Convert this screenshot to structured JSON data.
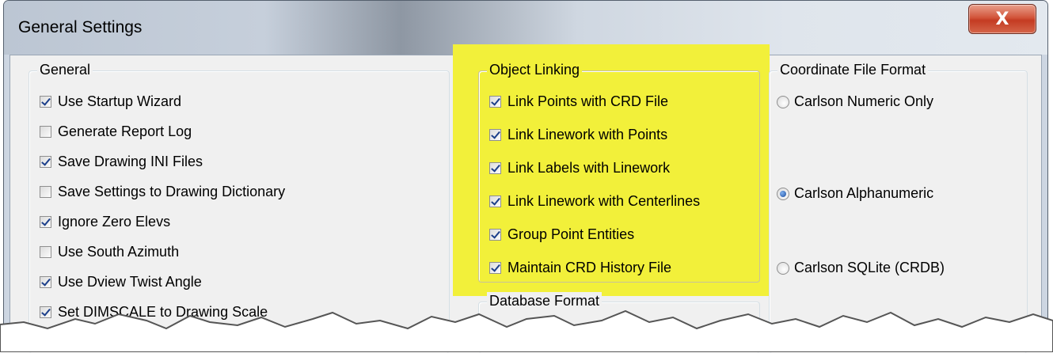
{
  "window": {
    "title": "General Settings",
    "close_icon": "close-icon",
    "close_label": "X"
  },
  "general": {
    "label": "General",
    "items": [
      {
        "label": "Use Startup Wizard",
        "checked": true
      },
      {
        "label": "Generate Report Log",
        "checked": false
      },
      {
        "label": "Save Drawing INI Files",
        "checked": true
      },
      {
        "label": "Save Settings to Drawing Dictionary",
        "checked": false
      },
      {
        "label": "Ignore Zero Elevs",
        "checked": true
      },
      {
        "label": "Use South Azimuth",
        "checked": false
      },
      {
        "label": "Use Dview Twist Angle",
        "checked": true
      },
      {
        "label": "Set DIMSCALE to Drawing Scale",
        "checked": true
      }
    ]
  },
  "object_linking": {
    "label": "Object Linking",
    "items": [
      {
        "label": "Link Points with CRD File",
        "checked": true
      },
      {
        "label": "Link Linework with Points",
        "checked": true
      },
      {
        "label": "Link Labels with Linework",
        "checked": true
      },
      {
        "label": "Link Linework with Centerlines",
        "checked": true
      },
      {
        "label": "Group Point Entities",
        "checked": true
      },
      {
        "label": "Maintain CRD History File",
        "checked": true
      }
    ]
  },
  "database_format": {
    "label": "Database Format"
  },
  "coordinate_file_format": {
    "label": "Coordinate File Format",
    "options": [
      {
        "label": "Carlson Numeric Only",
        "selected": false
      },
      {
        "label": "Carlson Alphanumeric",
        "selected": true
      },
      {
        "label": "Carlson SQLite (CRDB)",
        "selected": false
      }
    ]
  },
  "colors": {
    "highlight": "#f2f03a",
    "dialog_background": "#f0f0f0",
    "close_button": "#c9452c"
  }
}
